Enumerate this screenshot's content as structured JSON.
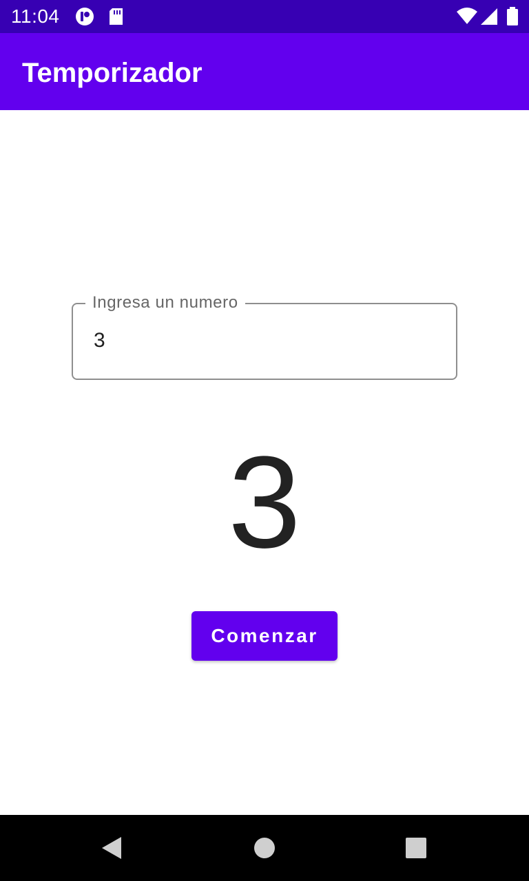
{
  "status_bar": {
    "time": "11:04",
    "left_icons": [
      "notification-circle-icon",
      "sd-card-icon"
    ],
    "right_icons": [
      "wifi-icon",
      "cell-signal-icon",
      "battery-icon"
    ],
    "background": "#3700b3"
  },
  "app_bar": {
    "title": "Temporizador",
    "background": "#6200ee"
  },
  "input": {
    "label": "Ingresa un numero",
    "value": "3"
  },
  "countdown": {
    "value": "3"
  },
  "start_button": {
    "label": "Comenzar",
    "color": "#6200ee"
  },
  "nav_bar": {
    "buttons": [
      "back-icon",
      "home-icon",
      "recents-icon"
    ]
  }
}
